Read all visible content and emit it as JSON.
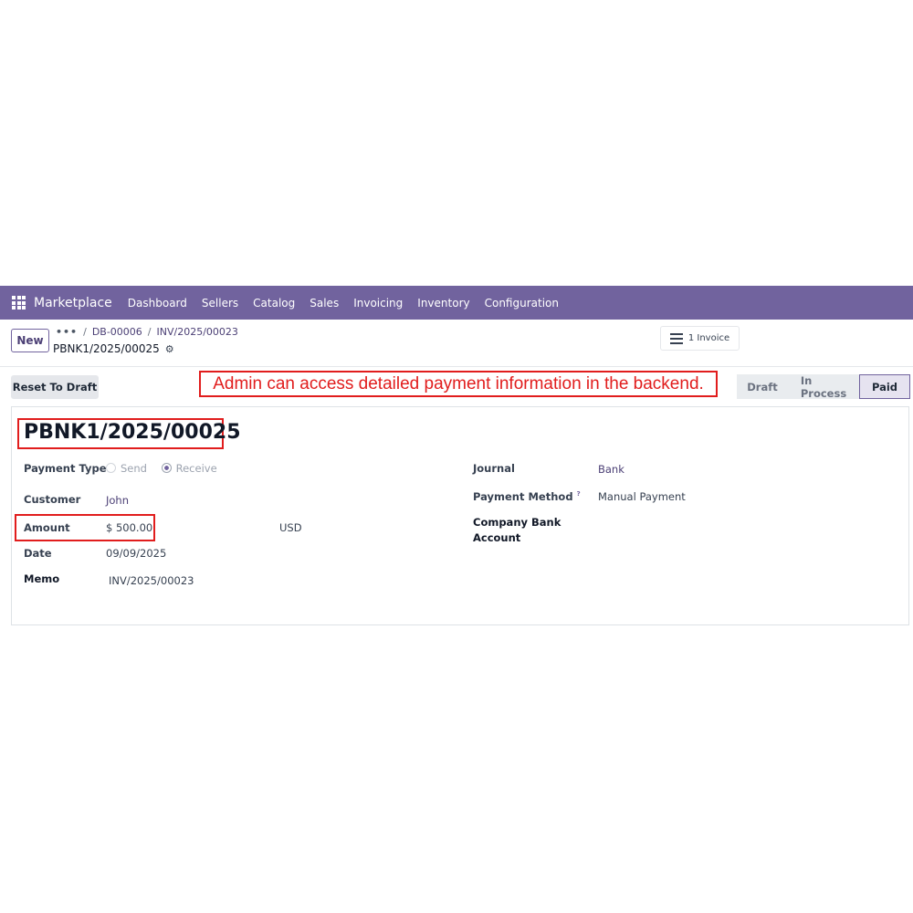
{
  "navbar": {
    "brand": "Marketplace",
    "menu": [
      "Dashboard",
      "Sellers",
      "Catalog",
      "Sales",
      "Invoicing",
      "Inventory",
      "Configuration"
    ]
  },
  "control": {
    "new_label": "New",
    "breadcrumb_dots": "•••",
    "breadcrumb": [
      "DB-00006",
      "INV/2025/00023"
    ],
    "record_name": "PBNK1/2025/00025",
    "invoice_button": "1 Invoice"
  },
  "statusbar": {
    "reset_label": "Reset To Draft",
    "annotation": "Admin can access detailed payment information in the backend.",
    "steps": [
      "Draft",
      "In Process",
      "Paid"
    ],
    "active_step": "Paid"
  },
  "form": {
    "title": "PBNK1/2025/00025",
    "payment_type_label": "Payment Type",
    "payment_type_options": [
      "Send",
      "Receive"
    ],
    "payment_type_selected": "Receive",
    "customer_label": "Customer",
    "customer_value": "John",
    "amount_label": "Amount",
    "amount_value": "$ 500.00",
    "currency": "USD",
    "date_label": "Date",
    "date_value": "09/09/2025",
    "memo_label": "Memo",
    "memo_value": "INV/2025/00023",
    "journal_label": "Journal",
    "journal_value": "Bank",
    "payment_method_label": "Payment Method",
    "payment_method_help": "?",
    "payment_method_value": "Manual Payment",
    "company_bank_label_1": "Company Bank",
    "company_bank_label_2": "Account"
  },
  "colors": {
    "navbar": "#71639e",
    "annotation": "#e11d1d",
    "link": "#4b3f75"
  }
}
